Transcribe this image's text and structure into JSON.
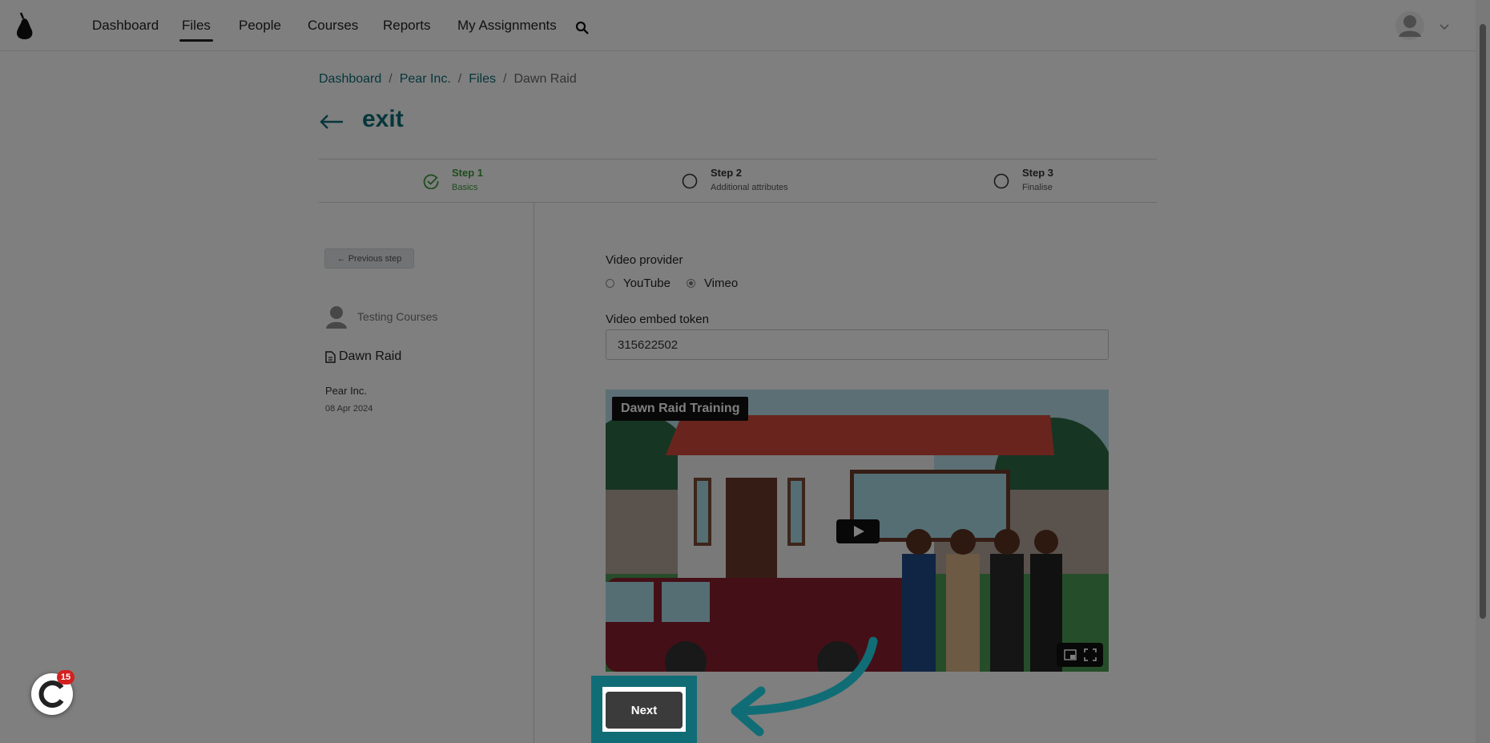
{
  "nav": {
    "items": [
      {
        "label": "Dashboard"
      },
      {
        "label": "Files"
      },
      {
        "label": "People"
      },
      {
        "label": "Courses"
      },
      {
        "label": "Reports"
      },
      {
        "label": "My Assignments"
      }
    ],
    "active": "Files"
  },
  "breadcrumb": {
    "items": [
      {
        "label": "Dashboard"
      },
      {
        "label": "Pear Inc."
      },
      {
        "label": "Files"
      }
    ],
    "separator": "/",
    "current": "Dawn Raid"
  },
  "page": {
    "title": "exit"
  },
  "stepper": {
    "steps": [
      {
        "name": "Step 1",
        "sub": "Basics",
        "status": "complete"
      },
      {
        "name": "Step 2",
        "sub": "Additional attributes",
        "status": "pending"
      },
      {
        "name": "Step 3",
        "sub": "Finalise",
        "status": "pending"
      }
    ]
  },
  "sidebar": {
    "prev_label": "← Previous step",
    "course": "Testing Courses",
    "file_name": "Dawn Raid",
    "org": "Pear Inc.",
    "date": "08 Apr 2024"
  },
  "form": {
    "provider_label": "Video provider",
    "providers": [
      {
        "label": "YouTube",
        "checked": false
      },
      {
        "label": "Vimeo",
        "checked": true
      }
    ],
    "token_label": "Video embed token",
    "token_value": "315622502"
  },
  "video": {
    "title": "Dawn Raid Training"
  },
  "actions": {
    "next_label": "Next"
  },
  "widget": {
    "badge": "15"
  },
  "colors": {
    "accent": "#0d6c76",
    "highlight": "#106d76",
    "step_done": "#3b9b3b",
    "badge": "#d32020"
  }
}
